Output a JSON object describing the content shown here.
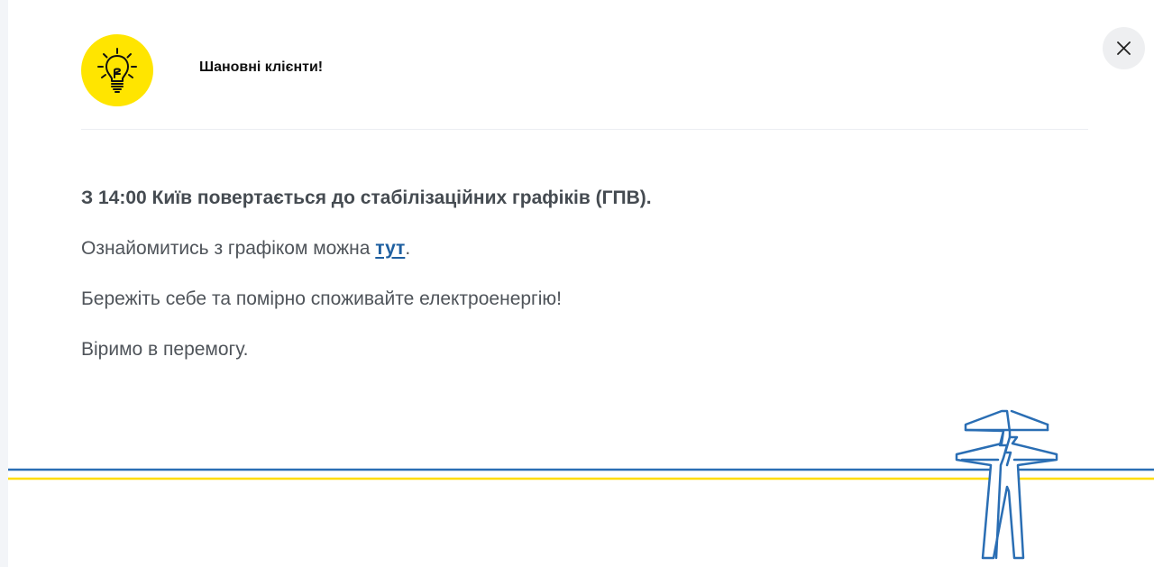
{
  "header": {
    "title": "Шановні клієнти!",
    "icon": "lightbulb-icon",
    "close_icon": "close-icon"
  },
  "message": {
    "lead": "З 14:00 Київ повертається до стабілізаційних графіків (ГПВ).",
    "schedule_prefix": "Ознайомитись з графіком можна ",
    "schedule_link": "тут",
    "schedule_suffix": ".",
    "advice": "Бережіть себе та помірно споживайте електроенергію!",
    "closing": "Віримо в перемогу."
  },
  "colors": {
    "accent_yellow": "#ffe500",
    "brand_blue": "#1e5fa0",
    "line_blue": "#2a6eb4",
    "line_yellow": "#ffdd00"
  }
}
